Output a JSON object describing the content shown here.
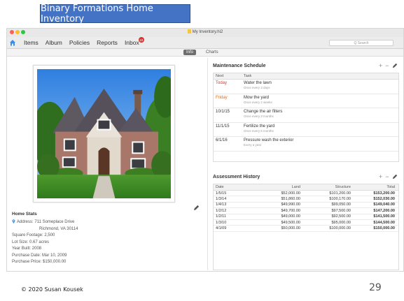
{
  "slide": {
    "title": "Binary Formations Home Inventory",
    "footer": "© 2020 Susan Kousek",
    "page_number": "29"
  },
  "window": {
    "doc_title": "My Inventory.hi2",
    "nav": [
      {
        "label": "Items"
      },
      {
        "label": "Album"
      },
      {
        "label": "Policies"
      },
      {
        "label": "Reports"
      },
      {
        "label": "Inbox",
        "badge": "10"
      }
    ],
    "search_placeholder": "Q Search",
    "tabs": {
      "info": "Info",
      "charts": "Charts"
    }
  },
  "home_stats": {
    "title": "Home Stats",
    "address_label": "Address:",
    "address_line1": "711 Someplace Drive",
    "address_line2": "Richmond, VA 30114",
    "square_footage": "Square Footage:  2,500",
    "lot_size": "Lot Size:  0.67 acres",
    "year_built": "Year Built:  2008",
    "purchase_date": "Purchase Date:  Mar 10, 2009",
    "purchase_price": "Purchase Price:  $150,000.00"
  },
  "maintenance": {
    "title": "Maintenance Schedule",
    "col_next": "Next",
    "col_task": "Task",
    "rows": [
      {
        "next": "Today",
        "task": "Water the lawn",
        "freq": "Once every 3 days"
      },
      {
        "next": "Friday",
        "task": "Mow the yard",
        "freq": "Once every 2 weeks"
      },
      {
        "next": "10/1/15",
        "task": "Change the air filters",
        "freq": "Once every 3 months"
      },
      {
        "next": "11/1/15",
        "task": "Fertilize the yard",
        "freq": "Once every 6 months"
      },
      {
        "next": "6/1/16",
        "task": "Pressure wash the exterior",
        "freq": "Every a year"
      }
    ]
  },
  "assessment": {
    "title": "Assessment History",
    "col_date": "Date",
    "col_land": "Land",
    "col_structure": "Structure",
    "col_total": "Total",
    "rows": [
      {
        "date": "1/5/15",
        "land": "$52,000.00",
        "structure": "$101,200.00",
        "total": "$153,200.00"
      },
      {
        "date": "1/3/14",
        "land": "$51,860.00",
        "structure": "$100,170.00",
        "total": "$152,030.00"
      },
      {
        "date": "1/4/13",
        "land": "$49,990.00",
        "structure": "$99,050.00",
        "total": "$149,040.00"
      },
      {
        "date": "1/2/12",
        "land": "$49,700.00",
        "structure": "$97,500.00",
        "total": "$147,200.00"
      },
      {
        "date": "1/2/11",
        "land": "$49,000.00",
        "structure": "$92,500.00",
        "total": "$141,500.00"
      },
      {
        "date": "1/3/10",
        "land": "$49,500.00",
        "structure": "$95,000.00",
        "total": "$144,500.00"
      },
      {
        "date": "4/1/09",
        "land": "$50,000.00",
        "structure": "$100,000.00",
        "total": "$150,000.00"
      }
    ]
  },
  "tools": {
    "add": "+",
    "remove": "−"
  },
  "colors": {
    "title_box": "#4472c4",
    "badge": "#e0322f",
    "today": "#d23a2b",
    "friday": "#d9702a"
  }
}
